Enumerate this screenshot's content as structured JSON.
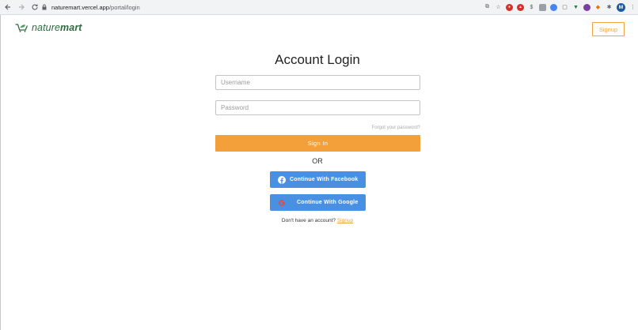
{
  "browser": {
    "url_host": "naturemart.vercel.app",
    "url_path": "/portal/login",
    "profile_initial": "M"
  },
  "brand": {
    "name_light": "nature",
    "name_bold": "mart",
    "accent_color": "#f3a03a",
    "social_color": "#4a90e2",
    "brand_green": "#2e6b3f"
  },
  "header": {
    "signup_label": "Signup"
  },
  "login": {
    "title": "Account Login",
    "username_placeholder": "Username",
    "username_value": "",
    "password_placeholder": "Password",
    "password_value": "",
    "forgot_label": "Forgot your password?",
    "signin_label": "Sign In",
    "or_label": "OR",
    "facebook_label": "Continue With Facebook",
    "google_label": "Continue With Google",
    "no_account_text": "Don't have an account?",
    "signup_link": "Signup"
  },
  "icons": {
    "back": "arrow-left-icon",
    "forward": "arrow-right-icon",
    "reload": "reload-icon",
    "lock": "lock-icon",
    "bookmark": "star-icon",
    "facebook": "facebook-icon",
    "google": "google-icon",
    "logo": "cart-leaf-icon"
  }
}
